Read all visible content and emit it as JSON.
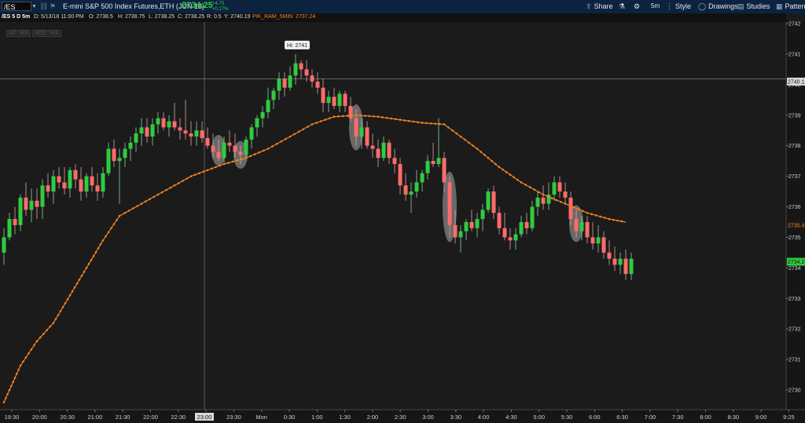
{
  "header": {
    "symbol": "/ES",
    "description": "E-mini S&P 500 Index Futures,ETH (JUN 18)",
    "last_price": "2734.25",
    "change": "+4.75",
    "change_pct": "+0.17%",
    "toolbar": {
      "share": "Share",
      "interval": "5m",
      "style": "Style",
      "drawings": "Drawings",
      "studies": "Studies",
      "patterns": "Patterns"
    }
  },
  "ohlc_bar": {
    "label": "/ES 5 D 5m",
    "date": "D: 5/13/18 11:00 PM",
    "open": "O: 2738.5",
    "high": "H: 2738.75",
    "low": "L: 2738.25",
    "close": "C: 2738.25",
    "range": "R: 0.5",
    "y": "Y: 2740.19",
    "study_name": "PIK_RAM_5MIN",
    "study_value": "2737.24",
    "badges": [
      "AD: N/A",
      "ADD: N/A"
    ]
  },
  "chart_data": {
    "type": "candlestick",
    "ylim": [
      2729,
      2742.5
    ],
    "y_ticks": [
      2730,
      2731,
      2732,
      2733,
      2734,
      2735,
      2736,
      2737,
      2738,
      2739,
      2740,
      2741,
      2742
    ],
    "x_ticks": [
      "19:30",
      "20:00",
      "20:30",
      "21:00",
      "21:30",
      "22:00",
      "22:30",
      "23:00",
      "23:30",
      "Mon",
      "0:30",
      "1:00",
      "1:30",
      "2:00",
      "2:30",
      "3:00",
      "3:30",
      "4:00",
      "4:30",
      "5:00",
      "5:30",
      "6:00",
      "6:30",
      "7:00",
      "7:30",
      "8:00",
      "8:30",
      "9:00",
      "9:25"
    ],
    "hi_label": "Hi: 2741",
    "crosshair": {
      "time": "23:00",
      "price": "2740.19"
    },
    "price_labels": {
      "study": "2735.4",
      "last": "2734.2",
      "crosshair": "2740.1"
    },
    "colors": {
      "up": "#2ecc40",
      "down": "#ff6b6b",
      "ma": "#f58220",
      "background": "#1b1b1b"
    },
    "ma_series": {
      "name": "PIK_RAM_5MIN",
      "points": [
        [
          0,
          2729.6
        ],
        [
          3,
          2730.8
        ],
        [
          6,
          2731.6
        ],
        [
          9,
          2732.2
        ],
        [
          12,
          2733.1
        ],
        [
          15,
          2734.0
        ],
        [
          18,
          2734.9
        ],
        [
          21,
          2735.7
        ],
        [
          22,
          2735.8
        ],
        [
          25,
          2736.1
        ],
        [
          28,
          2736.4
        ],
        [
          31,
          2736.7
        ],
        [
          34,
          2737.0
        ],
        [
          37,
          2737.2
        ],
        [
          40,
          2737.4
        ],
        [
          44,
          2737.6
        ],
        [
          48,
          2737.9
        ],
        [
          52,
          2738.3
        ],
        [
          56,
          2738.7
        ],
        [
          60,
          2738.95
        ],
        [
          64,
          2739.0
        ],
        [
          68,
          2738.95
        ],
        [
          72,
          2738.85
        ],
        [
          76,
          2738.75
        ],
        [
          80,
          2738.7
        ],
        [
          83,
          2738.3
        ],
        [
          86,
          2737.9
        ],
        [
          90,
          2737.3
        ],
        [
          94,
          2736.8
        ],
        [
          98,
          2736.4
        ],
        [
          102,
          2736.1
        ],
        [
          106,
          2735.8
        ],
        [
          110,
          2735.6
        ],
        [
          113,
          2735.5
        ]
      ]
    },
    "candles": [
      {
        "o": 2734.5,
        "h": 2735.3,
        "l": 2734.1,
        "c": 2735.0
      },
      {
        "o": 2735.0,
        "h": 2735.8,
        "l": 2734.9,
        "c": 2735.6
      },
      {
        "o": 2735.6,
        "h": 2736.0,
        "l": 2735.1,
        "c": 2735.4
      },
      {
        "o": 2735.4,
        "h": 2736.4,
        "l": 2735.2,
        "c": 2736.3
      },
      {
        "o": 2736.3,
        "h": 2736.8,
        "l": 2735.7,
        "c": 2735.9
      },
      {
        "o": 2735.9,
        "h": 2736.6,
        "l": 2735.5,
        "c": 2736.2
      },
      {
        "o": 2736.2,
        "h": 2736.6,
        "l": 2735.6,
        "c": 2736.0
      },
      {
        "o": 2736.0,
        "h": 2736.9,
        "l": 2735.6,
        "c": 2736.7
      },
      {
        "o": 2736.7,
        "h": 2737.1,
        "l": 2736.3,
        "c": 2736.5
      },
      {
        "o": 2736.5,
        "h": 2737.2,
        "l": 2736.1,
        "c": 2737.0
      },
      {
        "o": 2737.0,
        "h": 2737.3,
        "l": 2736.6,
        "c": 2736.8
      },
      {
        "o": 2736.8,
        "h": 2737.3,
        "l": 2736.4,
        "c": 2736.6
      },
      {
        "o": 2736.6,
        "h": 2737.3,
        "l": 2736.3,
        "c": 2737.2
      },
      {
        "o": 2737.2,
        "h": 2737.4,
        "l": 2736.6,
        "c": 2736.9
      },
      {
        "o": 2736.9,
        "h": 2737.3,
        "l": 2736.2,
        "c": 2736.5
      },
      {
        "o": 2736.5,
        "h": 2737.1,
        "l": 2736.3,
        "c": 2737.0
      },
      {
        "o": 2737.0,
        "h": 2737.3,
        "l": 2736.5,
        "c": 2736.7
      },
      {
        "o": 2736.7,
        "h": 2737.1,
        "l": 2736.2,
        "c": 2736.5
      },
      {
        "o": 2736.5,
        "h": 2737.3,
        "l": 2736.3,
        "c": 2737.1
      },
      {
        "o": 2737.1,
        "h": 2738.1,
        "l": 2737.0,
        "c": 2737.9
      },
      {
        "o": 2737.9,
        "h": 2738.2,
        "l": 2737.3,
        "c": 2737.5
      },
      {
        "o": 2737.5,
        "h": 2737.9,
        "l": 2736.1,
        "c": 2737.6
      },
      {
        "o": 2737.6,
        "h": 2738.1,
        "l": 2737.3,
        "c": 2737.9
      },
      {
        "o": 2737.9,
        "h": 2738.3,
        "l": 2737.5,
        "c": 2738.1
      },
      {
        "o": 2738.1,
        "h": 2738.6,
        "l": 2737.8,
        "c": 2738.4
      },
      {
        "o": 2738.4,
        "h": 2738.9,
        "l": 2738.0,
        "c": 2738.6
      },
      {
        "o": 2738.6,
        "h": 2738.9,
        "l": 2738.1,
        "c": 2738.3
      },
      {
        "o": 2738.3,
        "h": 2738.9,
        "l": 2738.0,
        "c": 2738.7
      },
      {
        "o": 2738.7,
        "h": 2739.1,
        "l": 2738.4,
        "c": 2738.9
      },
      {
        "o": 2738.9,
        "h": 2739.1,
        "l": 2738.5,
        "c": 2738.6
      },
      {
        "o": 2738.6,
        "h": 2739.0,
        "l": 2738.3,
        "c": 2738.8
      },
      {
        "o": 2738.8,
        "h": 2739.4,
        "l": 2738.5,
        "c": 2738.6
      },
      {
        "o": 2738.6,
        "h": 2738.9,
        "l": 2738.2,
        "c": 2738.5
      },
      {
        "o": 2738.5,
        "h": 2739.5,
        "l": 2738.2,
        "c": 2738.4
      },
      {
        "o": 2738.4,
        "h": 2738.8,
        "l": 2738.0,
        "c": 2738.3
      },
      {
        "o": 2738.3,
        "h": 2738.8,
        "l": 2738.0,
        "c": 2738.5
      },
      {
        "o": 2738.5,
        "h": 2738.8,
        "l": 2738.1,
        "c": 2738.25
      },
      {
        "o": 2738.25,
        "h": 2738.6,
        "l": 2737.9,
        "c": 2738.0
      },
      {
        "o": 2738.0,
        "h": 2738.4,
        "l": 2737.6,
        "c": 2737.8
      },
      {
        "o": 2737.8,
        "h": 2738.2,
        "l": 2737.5,
        "c": 2737.6
      },
      {
        "o": 2737.6,
        "h": 2738.3,
        "l": 2737.4,
        "c": 2738.1
      },
      {
        "o": 2738.1,
        "h": 2738.5,
        "l": 2737.8,
        "c": 2738.0
      },
      {
        "o": 2738.0,
        "h": 2738.4,
        "l": 2737.6,
        "c": 2737.8
      },
      {
        "o": 2737.8,
        "h": 2738.0,
        "l": 2737.4,
        "c": 2737.7
      },
      {
        "o": 2737.7,
        "h": 2738.3,
        "l": 2737.6,
        "c": 2738.2
      },
      {
        "o": 2738.2,
        "h": 2738.7,
        "l": 2737.9,
        "c": 2738.6
      },
      {
        "o": 2738.6,
        "h": 2739.0,
        "l": 2738.3,
        "c": 2738.9
      },
      {
        "o": 2738.9,
        "h": 2739.3,
        "l": 2738.6,
        "c": 2739.1
      },
      {
        "o": 2739.1,
        "h": 2739.9,
        "l": 2738.9,
        "c": 2739.5
      },
      {
        "o": 2739.5,
        "h": 2739.9,
        "l": 2739.2,
        "c": 2739.8
      },
      {
        "o": 2739.8,
        "h": 2740.4,
        "l": 2739.5,
        "c": 2740.2
      },
      {
        "o": 2740.2,
        "h": 2740.4,
        "l": 2739.6,
        "c": 2739.9
      },
      {
        "o": 2739.9,
        "h": 2740.6,
        "l": 2739.8,
        "c": 2740.3
      },
      {
        "o": 2740.3,
        "h": 2741.0,
        "l": 2740.0,
        "c": 2740.7
      },
      {
        "o": 2740.7,
        "h": 2740.8,
        "l": 2740.2,
        "c": 2740.5
      },
      {
        "o": 2740.5,
        "h": 2740.8,
        "l": 2740.1,
        "c": 2740.3
      },
      {
        "o": 2740.3,
        "h": 2740.5,
        "l": 2739.9,
        "c": 2740.1
      },
      {
        "o": 2740.1,
        "h": 2740.4,
        "l": 2739.7,
        "c": 2739.9
      },
      {
        "o": 2739.9,
        "h": 2740.2,
        "l": 2739.1,
        "c": 2739.4
      },
      {
        "o": 2739.4,
        "h": 2739.8,
        "l": 2739.1,
        "c": 2739.6
      },
      {
        "o": 2739.6,
        "h": 2739.9,
        "l": 2739.2,
        "c": 2739.3
      },
      {
        "o": 2739.3,
        "h": 2739.8,
        "l": 2739.1,
        "c": 2739.7
      },
      {
        "o": 2739.7,
        "h": 2739.8,
        "l": 2739.1,
        "c": 2739.3
      },
      {
        "o": 2739.3,
        "h": 2739.6,
        "l": 2738.8,
        "c": 2738.9
      },
      {
        "o": 2738.9,
        "h": 2739.2,
        "l": 2738.0,
        "c": 2738.3
      },
      {
        "o": 2738.3,
        "h": 2738.9,
        "l": 2737.9,
        "c": 2738.6
      },
      {
        "o": 2738.6,
        "h": 2738.8,
        "l": 2737.9,
        "c": 2738.0
      },
      {
        "o": 2738.0,
        "h": 2738.4,
        "l": 2737.6,
        "c": 2737.9
      },
      {
        "o": 2737.9,
        "h": 2738.2,
        "l": 2737.3,
        "c": 2737.6
      },
      {
        "o": 2737.6,
        "h": 2738.3,
        "l": 2737.5,
        "c": 2738.1
      },
      {
        "o": 2738.1,
        "h": 2738.2,
        "l": 2737.4,
        "c": 2737.6
      },
      {
        "o": 2737.6,
        "h": 2737.9,
        "l": 2737.1,
        "c": 2737.4
      },
      {
        "o": 2737.4,
        "h": 2737.6,
        "l": 2736.4,
        "c": 2736.7
      },
      {
        "o": 2736.7,
        "h": 2737.1,
        "l": 2736.2,
        "c": 2736.4
      },
      {
        "o": 2736.4,
        "h": 2736.8,
        "l": 2735.8,
        "c": 2736.5
      },
      {
        "o": 2736.5,
        "h": 2737.2,
        "l": 2736.3,
        "c": 2736.8
      },
      {
        "o": 2736.8,
        "h": 2737.2,
        "l": 2736.5,
        "c": 2737.1
      },
      {
        "o": 2737.1,
        "h": 2737.7,
        "l": 2736.9,
        "c": 2737.5
      },
      {
        "o": 2737.5,
        "h": 2738.1,
        "l": 2737.3,
        "c": 2737.4
      },
      {
        "o": 2737.4,
        "h": 2738.9,
        "l": 2737.3,
        "c": 2737.6
      },
      {
        "o": 2737.6,
        "h": 2737.8,
        "l": 2736.5,
        "c": 2736.8
      },
      {
        "o": 2736.8,
        "h": 2737.0,
        "l": 2735.0,
        "c": 2735.4
      },
      {
        "o": 2735.4,
        "h": 2735.9,
        "l": 2734.8,
        "c": 2735.0
      },
      {
        "o": 2735.0,
        "h": 2735.4,
        "l": 2734.5,
        "c": 2735.2
      },
      {
        "o": 2735.2,
        "h": 2735.6,
        "l": 2734.9,
        "c": 2735.5
      },
      {
        "o": 2735.5,
        "h": 2735.9,
        "l": 2735.2,
        "c": 2735.3
      },
      {
        "o": 2735.3,
        "h": 2735.8,
        "l": 2735.0,
        "c": 2735.6
      },
      {
        "o": 2735.6,
        "h": 2736.1,
        "l": 2735.2,
        "c": 2735.9
      },
      {
        "o": 2735.9,
        "h": 2736.6,
        "l": 2735.8,
        "c": 2736.5
      },
      {
        "o": 2736.5,
        "h": 2736.7,
        "l": 2735.6,
        "c": 2735.8
      },
      {
        "o": 2735.8,
        "h": 2736.0,
        "l": 2735.1,
        "c": 2735.3
      },
      {
        "o": 2735.3,
        "h": 2735.8,
        "l": 2734.9,
        "c": 2735.0
      },
      {
        "o": 2735.0,
        "h": 2735.3,
        "l": 2734.6,
        "c": 2734.9
      },
      {
        "o": 2734.9,
        "h": 2735.3,
        "l": 2734.6,
        "c": 2735.1
      },
      {
        "o": 2735.1,
        "h": 2735.7,
        "l": 2735.0,
        "c": 2735.5
      },
      {
        "o": 2735.5,
        "h": 2735.8,
        "l": 2735.1,
        "c": 2735.3
      },
      {
        "o": 2735.3,
        "h": 2736.2,
        "l": 2735.2,
        "c": 2736.0
      },
      {
        "o": 2736.0,
        "h": 2736.5,
        "l": 2735.7,
        "c": 2736.3
      },
      {
        "o": 2736.3,
        "h": 2736.7,
        "l": 2735.9,
        "c": 2736.1
      },
      {
        "o": 2736.1,
        "h": 2736.8,
        "l": 2735.9,
        "c": 2736.4
      },
      {
        "o": 2736.4,
        "h": 2737.0,
        "l": 2736.2,
        "c": 2736.8
      },
      {
        "o": 2736.8,
        "h": 2737.0,
        "l": 2736.3,
        "c": 2736.5
      },
      {
        "o": 2736.5,
        "h": 2736.8,
        "l": 2736.1,
        "c": 2736.3
      },
      {
        "o": 2736.3,
        "h": 2736.5,
        "l": 2735.4,
        "c": 2735.6
      },
      {
        "o": 2735.6,
        "h": 2735.9,
        "l": 2735.0,
        "c": 2735.2
      },
      {
        "o": 2735.2,
        "h": 2735.7,
        "l": 2734.9,
        "c": 2735.5
      },
      {
        "o": 2735.5,
        "h": 2735.7,
        "l": 2734.8,
        "c": 2735.0
      },
      {
        "o": 2735.0,
        "h": 2735.5,
        "l": 2734.6,
        "c": 2734.8
      },
      {
        "o": 2734.8,
        "h": 2735.4,
        "l": 2734.5,
        "c": 2735.0
      },
      {
        "o": 2735.0,
        "h": 2735.2,
        "l": 2734.3,
        "c": 2734.5
      },
      {
        "o": 2734.5,
        "h": 2734.9,
        "l": 2734.1,
        "c": 2734.3
      },
      {
        "o": 2734.3,
        "h": 2734.7,
        "l": 2733.9,
        "c": 2734.1
      },
      {
        "o": 2734.1,
        "h": 2734.5,
        "l": 2733.8,
        "c": 2734.3
      },
      {
        "o": 2734.3,
        "h": 2734.6,
        "l": 2733.6,
        "c": 2733.8
      },
      {
        "o": 2733.8,
        "h": 2734.5,
        "l": 2733.6,
        "c": 2734.3
      }
    ],
    "highlight_candles": [
      39,
      43,
      64,
      81,
      104
    ]
  }
}
